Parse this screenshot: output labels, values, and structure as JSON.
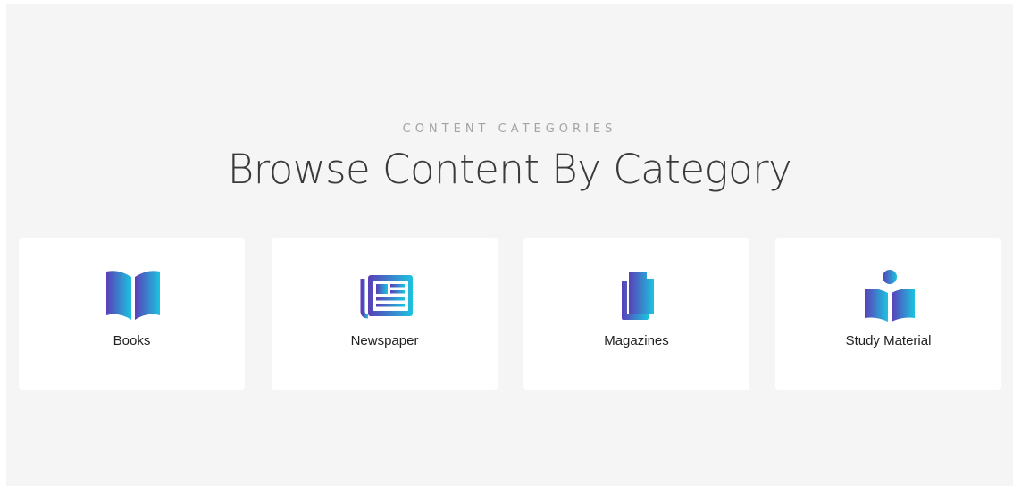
{
  "header": {
    "eyebrow": "CONTENT CATEGORIES",
    "title": "Browse Content By Category"
  },
  "categories": [
    {
      "label": "Books",
      "icon": "open-book-icon"
    },
    {
      "label": "Newspaper",
      "icon": "newspaper-icon"
    },
    {
      "label": "Magazines",
      "icon": "documents-icon"
    },
    {
      "label": "Study Material",
      "icon": "reader-icon"
    }
  ],
  "colors": {
    "background": "#f5f5f5",
    "card": "#ffffff",
    "gradient_start": "#5a3fb8",
    "gradient_end": "#1cc3df"
  }
}
